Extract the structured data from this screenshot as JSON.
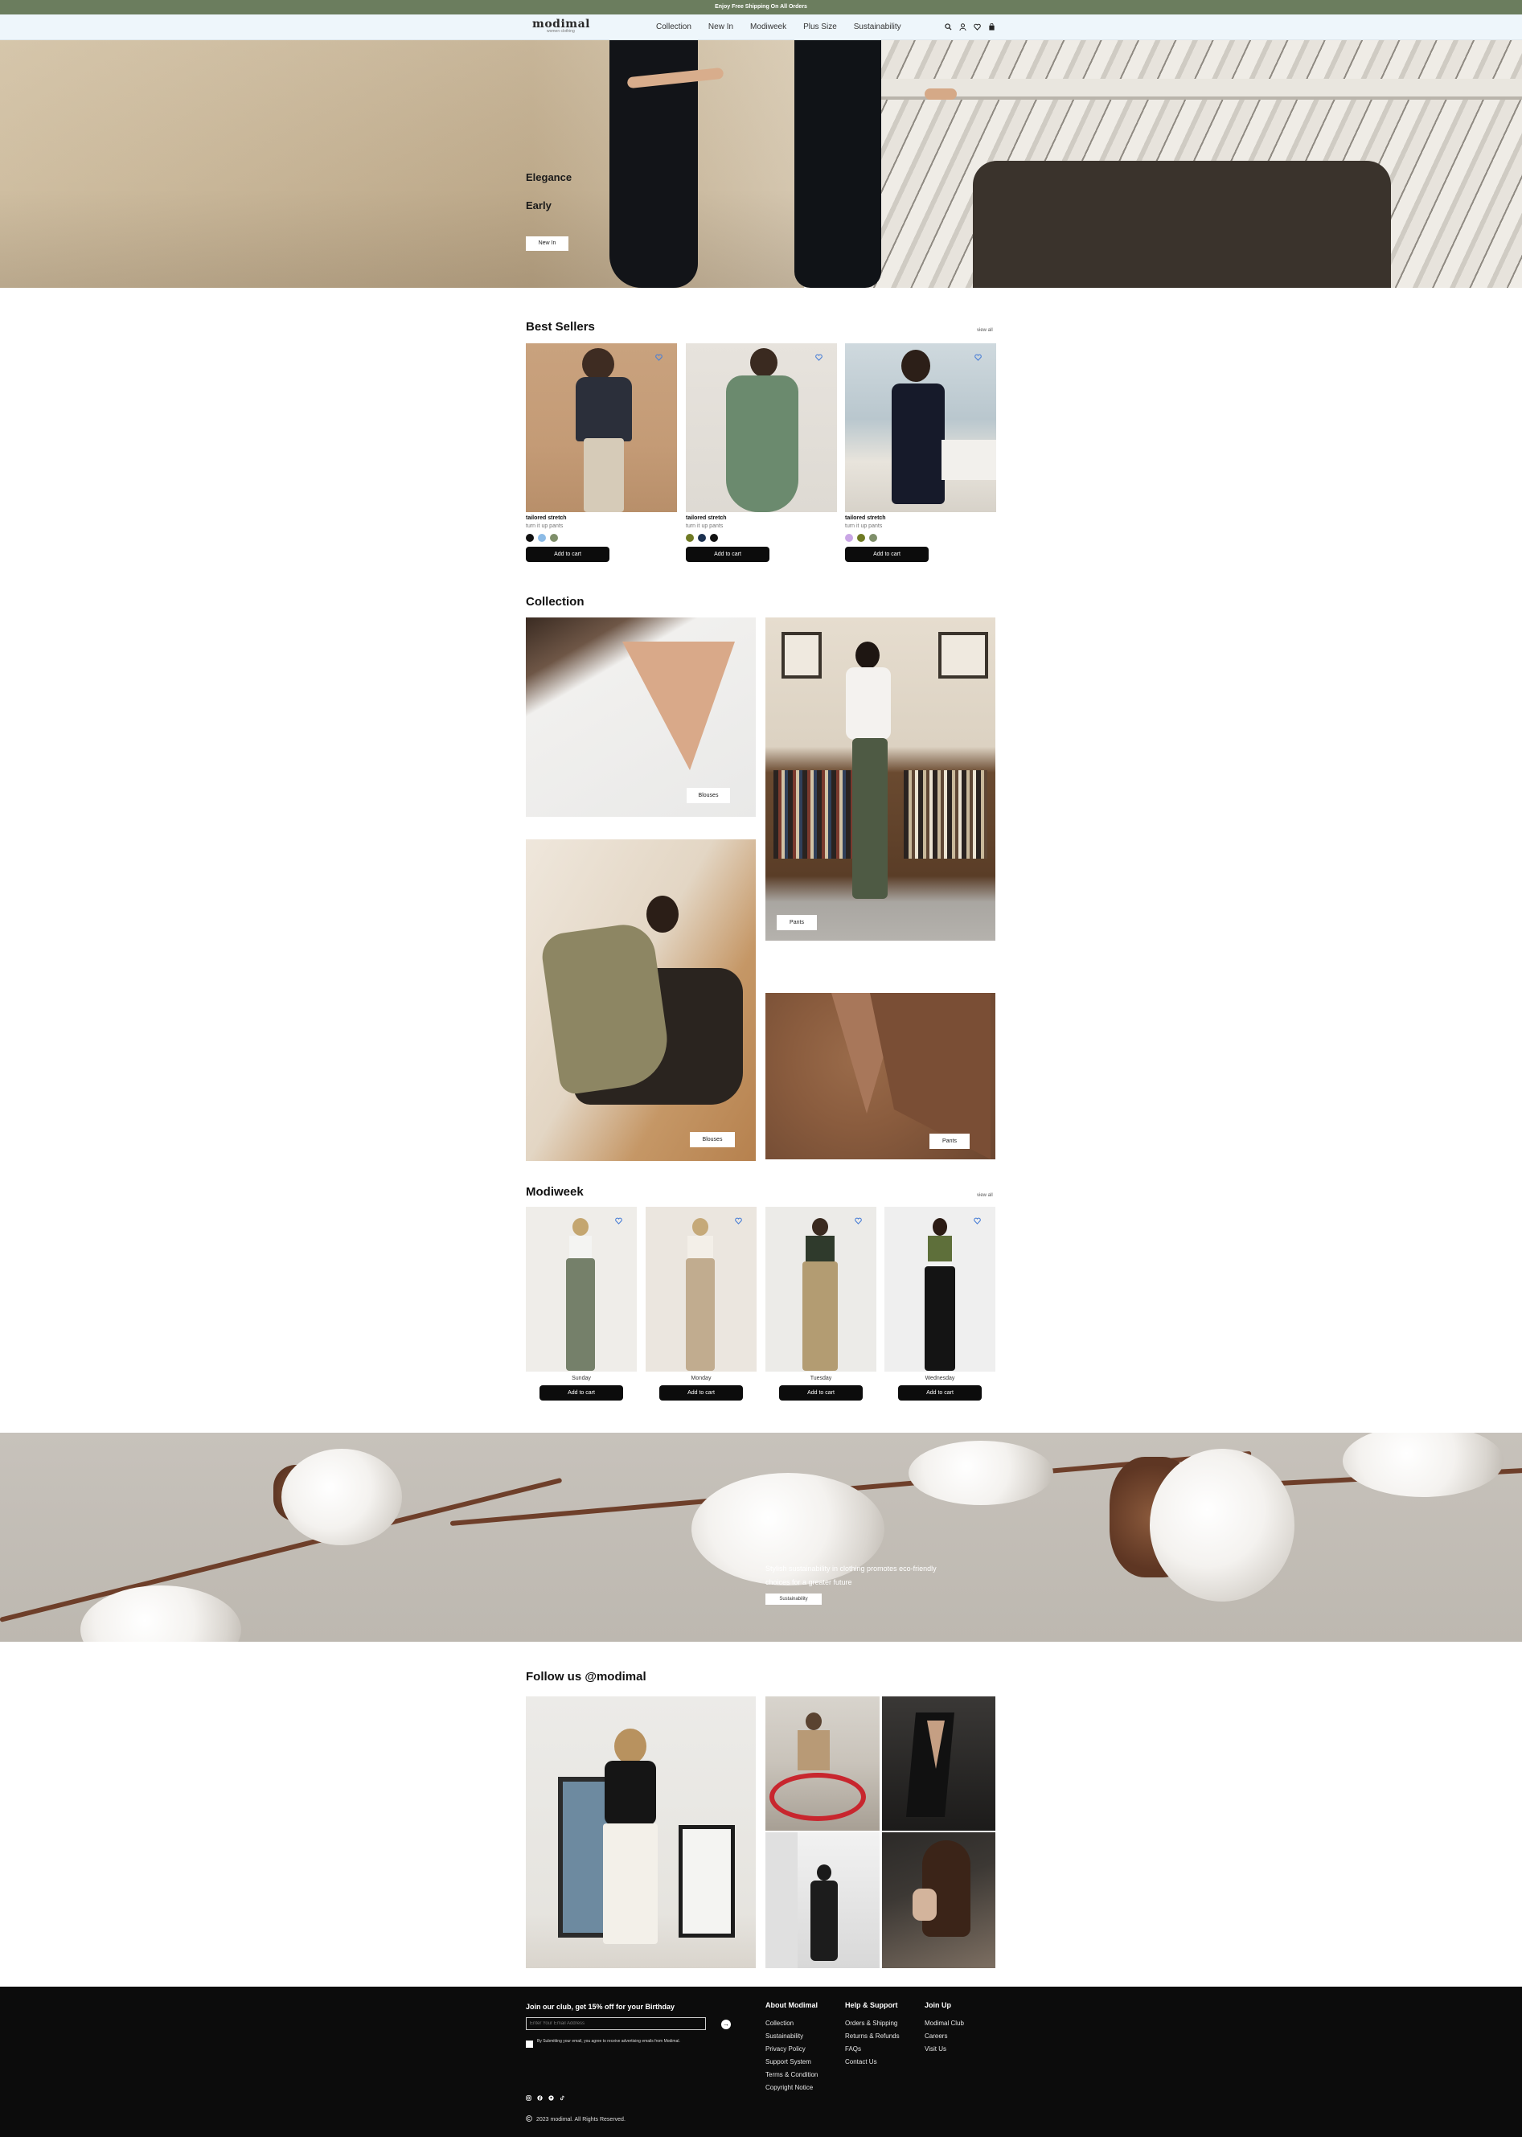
{
  "promo": {
    "text": "Enjoy Free Shipping On All Orders"
  },
  "header": {
    "logo": "modimal",
    "logo_tagline": "women clothing",
    "nav": [
      "Collection",
      "New In",
      "Modiweek",
      "Plus Size",
      "Sustainability"
    ],
    "icons": [
      "search-icon",
      "user-icon",
      "heart-icon",
      "bag-icon"
    ]
  },
  "hero": {
    "line1": "Elegance",
    "line2": "Early",
    "button": "New In"
  },
  "best_sellers": {
    "title": "Best Sellers",
    "view_all": "view all",
    "products": [
      {
        "name": "tailored stretch",
        "price": "turn it up pants",
        "swatches": [
          "#111111",
          "#8cbbe6",
          "#7f8f6a"
        ],
        "button": "Add to cart"
      },
      {
        "name": "tailored stretch",
        "price": "turn it up pants",
        "swatches": [
          "#6f7a24",
          "#1c3150",
          "#111111"
        ],
        "button": "Add to cart"
      },
      {
        "name": "tailored stretch",
        "price": "turn it up pants",
        "swatches": [
          "#c9a6e5",
          "#6f7a24",
          "#7f8f6a"
        ],
        "button": "Add to cart"
      }
    ]
  },
  "collection": {
    "title": "Collection",
    "tiles": [
      "Blouses",
      "Pants",
      "Blouses",
      "Pants"
    ]
  },
  "modiweek": {
    "title": "Modiweek",
    "view_all": "view all",
    "items": [
      {
        "day": "Sunday",
        "button": "Add to cart"
      },
      {
        "day": "Monday",
        "button": "Add to cart"
      },
      {
        "day": "Tuesday",
        "button": "Add to cart"
      },
      {
        "day": "Wednesday",
        "button": "Add to cart"
      }
    ]
  },
  "sustainability": {
    "text": "Stylish sustainability in clothing promotes eco-friendly choices for a greater future",
    "button": "Sustainability"
  },
  "follow": {
    "title": "Follow us @modimal"
  },
  "footer": {
    "join_title": "Join our club, get 15% off for your Birthday",
    "email_placeholder": "Enter Your Email Address",
    "consent": "By Submitting your email, you agree to receive advertising emails from Modimal.",
    "about": {
      "title": "About Modimal",
      "links": [
        "Collection",
        "Sustainability",
        "Privacy Policy",
        "Support System",
        "Terms & Condition",
        "Copyright Notice"
      ]
    },
    "help": {
      "title": "Help & Support",
      "links": [
        "Orders & Shipping",
        "Returns & Refunds",
        "FAQs",
        "Contact Us"
      ]
    },
    "join": {
      "title": "Join Up",
      "links": [
        "Modimal Club",
        "Careers",
        "Visit Us"
      ]
    },
    "copyright": "2023 modimal. All Rights Reserved."
  },
  "colors": {
    "promo": "#6b7d5e",
    "header": "#eef6fb",
    "footer": "#0c0c0c",
    "button": "#0c0c0c",
    "heart": "#4a7fd6"
  }
}
